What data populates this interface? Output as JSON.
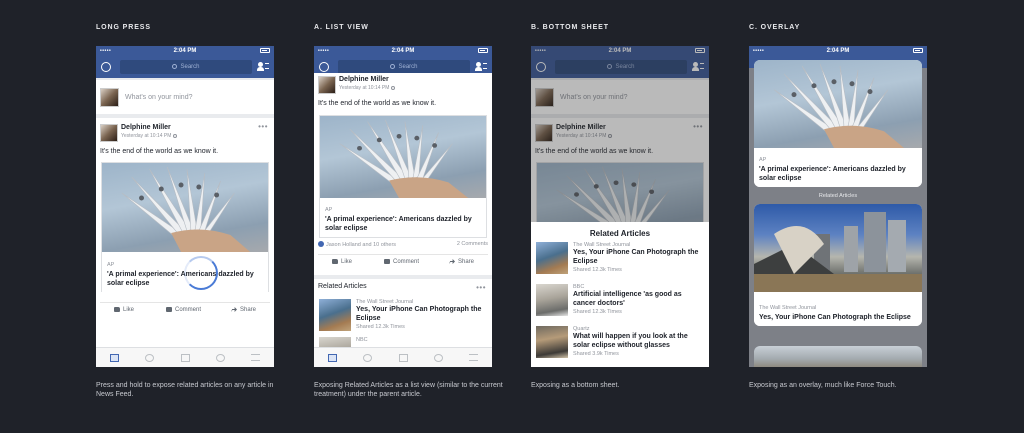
{
  "status_time": "2:04 PM",
  "carrier": "•••••",
  "search_placeholder": "Search",
  "compose_placeholder": "What's on your mind?",
  "post": {
    "author": "Delphine Miller",
    "time": "Yesterday at 10:14 PM",
    "text": "It's the end of the world as we know it.",
    "link_source": "AP",
    "link_title": "'A primal experience': Americans dazzled by solar eclipse",
    "reactions": "Jason Holland and 10 others",
    "comments": "2 Comments",
    "more": "•••"
  },
  "actions": {
    "like": "Like",
    "comment": "Comment",
    "share": "Share"
  },
  "related_header": "Related Articles",
  "related": [
    {
      "source": "The Wall Street Journal",
      "title": "Yes, Your iPhone Can Photograph the Eclipse",
      "shared": "Shared 12.3k Times"
    },
    {
      "source": "BBC",
      "title": "Artificial intelligence 'as good as cancer doctors'",
      "shared": "Shared 12.3k Times"
    },
    {
      "source": "Quartz",
      "title": "What will happen if you look at the solar eclipse without glasses",
      "shared": "Shared 3.9k Times"
    }
  ],
  "list_next_source": "NBC",
  "columns": [
    {
      "title": "LONG PRESS",
      "caption": "Press and hold to expose related articles on any article in News Feed."
    },
    {
      "title": "A. LIST VIEW",
      "caption": "Exposing Related Articles as a list view (similar to the current treatment) under the parent article."
    },
    {
      "title": "B. BOTTOM SHEET",
      "caption": "Exposing as a bottom sheet."
    },
    {
      "title": "C. OVERLAY",
      "caption": "Exposing as an overlay, much like Force Touch."
    }
  ],
  "colors": {
    "background": "#1f2229",
    "facebook_blue": "#3b5998",
    "press_ring": "#4a7bd6"
  }
}
